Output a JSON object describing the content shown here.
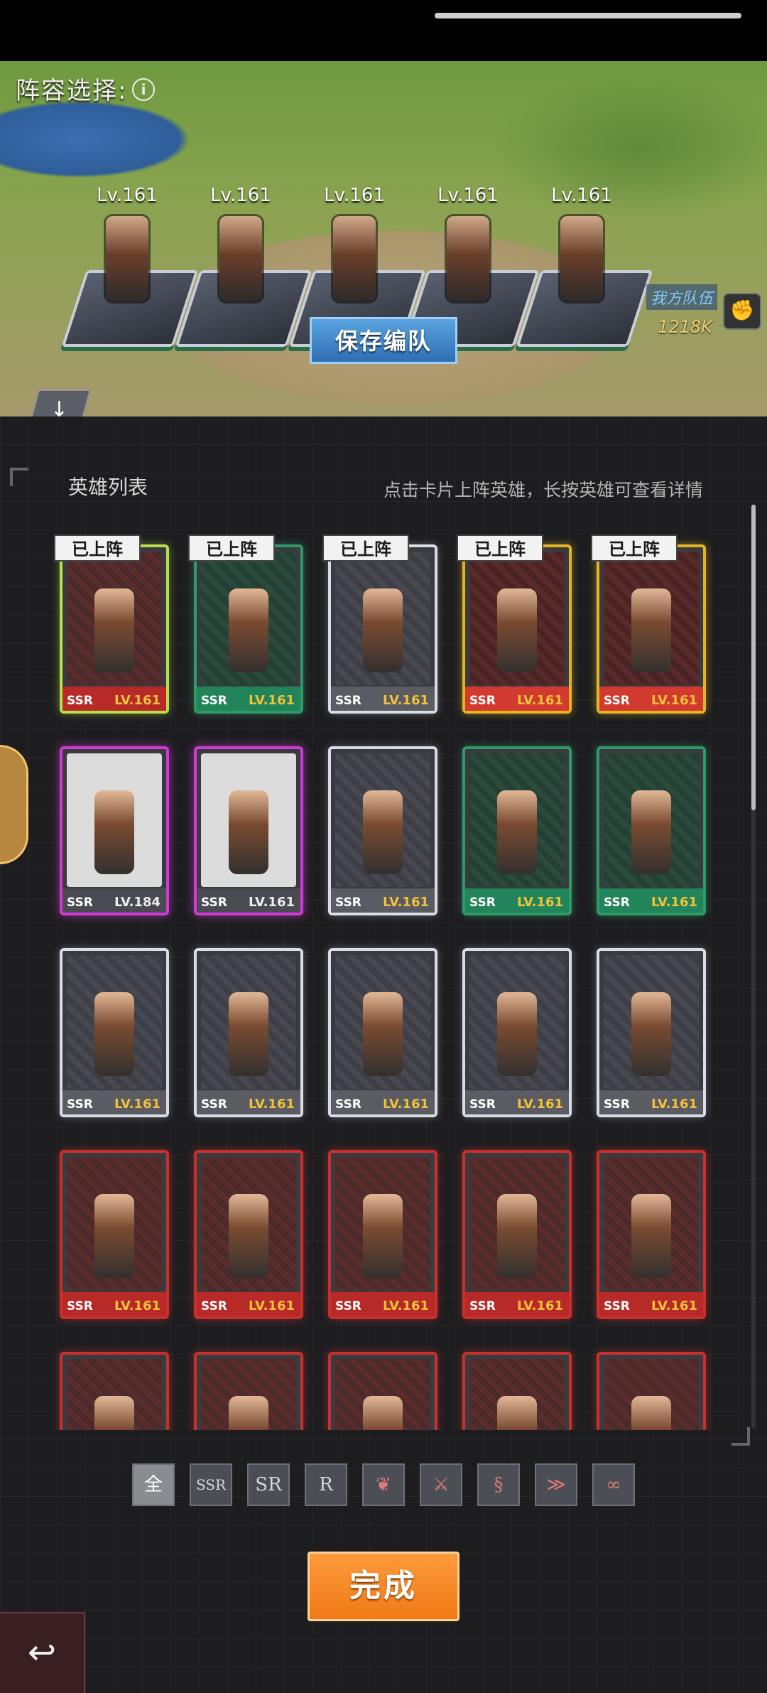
{
  "lineup": {
    "title": "阵容选择:",
    "slots": [
      {
        "level": "Lv.161"
      },
      {
        "level": "Lv.161"
      },
      {
        "level": "Lv.161"
      },
      {
        "level": "Lv.161"
      },
      {
        "level": "Lv.161"
      }
    ],
    "save_label": "保存编队",
    "team_label": "我方队伍",
    "power": "1218K"
  },
  "hero_list": {
    "title": "英雄列表",
    "hint": "点击卡片上阵英雄，长按英雄可查看详情",
    "deployed_label": "已上阵",
    "cards": [
      {
        "rarity": "SSR",
        "level": "LV.161",
        "color": "#b8e04a",
        "deployed": true
      },
      {
        "rarity": "SSR",
        "level": "LV.161",
        "color": "#2f9a66",
        "deployed": true
      },
      {
        "rarity": "SSR",
        "level": "LV.161",
        "color": "#d9dde6",
        "deployed": true
      },
      {
        "rarity": "SSR",
        "level": "LV.161",
        "color": "#e6b422",
        "deployed": true
      },
      {
        "rarity": "SSR",
        "level": "LV.161",
        "color": "#e6b422",
        "deployed": true
      },
      {
        "rarity": "SSR",
        "level": "LV.184",
        "color": "#d23ad6",
        "deployed": false
      },
      {
        "rarity": "SSR",
        "level": "LV.161",
        "color": "#d23ad6",
        "deployed": false
      },
      {
        "rarity": "SSR",
        "level": "LV.161",
        "color": "#d9dde6",
        "deployed": false
      },
      {
        "rarity": "SSR",
        "level": "LV.161",
        "color": "#2f9a66",
        "deployed": false
      },
      {
        "rarity": "SSR",
        "level": "LV.161",
        "color": "#2f9a66",
        "deployed": false
      },
      {
        "rarity": "SSR",
        "level": "LV.161",
        "color": "#d9dde6",
        "deployed": false
      },
      {
        "rarity": "SSR",
        "level": "LV.161",
        "color": "#d9dde6",
        "deployed": false
      },
      {
        "rarity": "SSR",
        "level": "LV.161",
        "color": "#d9dde6",
        "deployed": false
      },
      {
        "rarity": "SSR",
        "level": "LV.161",
        "color": "#d9dde6",
        "deployed": false
      },
      {
        "rarity": "SSR",
        "level": "LV.161",
        "color": "#d9dde6",
        "deployed": false
      },
      {
        "rarity": "SSR",
        "level": "LV.161",
        "color": "#c9302c",
        "deployed": false
      },
      {
        "rarity": "SSR",
        "level": "LV.161",
        "color": "#c9302c",
        "deployed": false
      },
      {
        "rarity": "SSR",
        "level": "LV.161",
        "color": "#c9302c",
        "deployed": false
      },
      {
        "rarity": "SSR",
        "level": "LV.161",
        "color": "#c9302c",
        "deployed": false
      },
      {
        "rarity": "SSR",
        "level": "LV.161",
        "color": "#c9302c",
        "deployed": false
      },
      {
        "rarity": "",
        "level": "",
        "color": "#c9302c",
        "deployed": false
      },
      {
        "rarity": "",
        "level": "",
        "color": "#c9302c",
        "deployed": false
      },
      {
        "rarity": "",
        "level": "",
        "color": "#c9302c",
        "deployed": false
      },
      {
        "rarity": "",
        "level": "",
        "color": "#c9302c",
        "deployed": false
      },
      {
        "rarity": "",
        "level": "",
        "color": "#c9302c",
        "deployed": false
      }
    ]
  },
  "filters": [
    {
      "label": "全",
      "active": true,
      "icon": "all"
    },
    {
      "label": "SSR",
      "active": false,
      "icon": "rarity-ssr"
    },
    {
      "label": "SR",
      "active": false,
      "icon": "rarity-sr"
    },
    {
      "label": "R",
      "active": false,
      "icon": "rarity-r"
    },
    {
      "label": "",
      "active": false,
      "icon": "faction-claw-icon"
    },
    {
      "label": "",
      "active": false,
      "icon": "faction-wolf-icon"
    },
    {
      "label": "",
      "active": false,
      "icon": "faction-serpent-icon"
    },
    {
      "label": "",
      "active": false,
      "icon": "faction-wing-icon"
    },
    {
      "label": "",
      "active": false,
      "icon": "faction-infinity-icon"
    }
  ],
  "done_label": "完成",
  "colors": {
    "accent": "#f07a16",
    "save": "#2f6fb4"
  }
}
